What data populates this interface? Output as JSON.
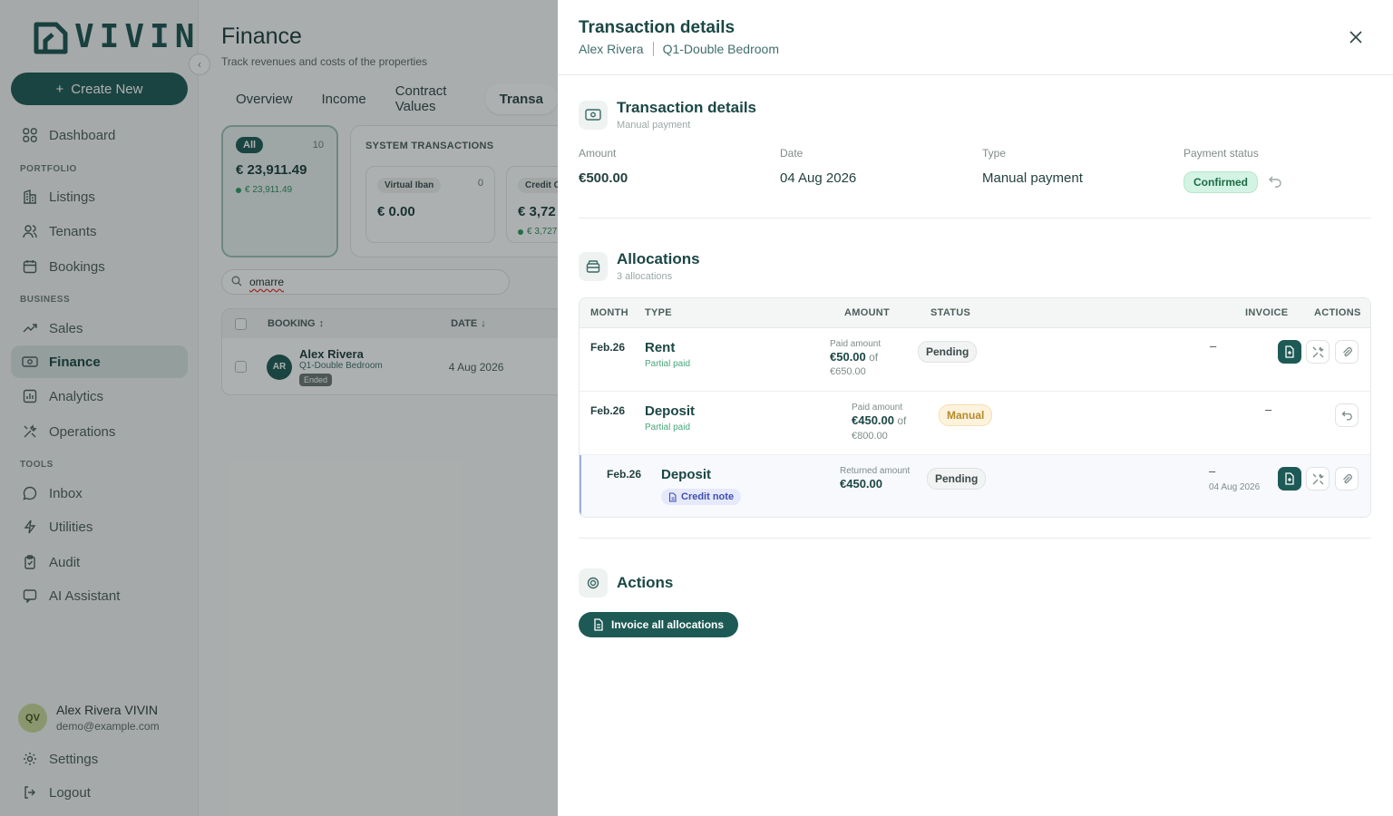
{
  "brand": {
    "name": "VIVIN"
  },
  "sidebar": {
    "create_label": "Create New",
    "dashboard": "Dashboard",
    "sections": {
      "portfolio": "PORTFOLIO",
      "business": "BUSINESS",
      "tools": "TOOLS"
    },
    "items": {
      "listings": "Listings",
      "tenants": "Tenants",
      "bookings": "Bookings",
      "sales": "Sales",
      "finance": "Finance",
      "analytics": "Analytics",
      "operations": "Operations",
      "inbox": "Inbox",
      "utilities": "Utilities",
      "audit": "Audit",
      "ai_assistant": "AI Assistant"
    },
    "user": {
      "initials": "QV",
      "name": "Alex Rivera VIVIN",
      "email": "demo@example.com"
    },
    "settings": "Settings",
    "logout": "Logout"
  },
  "main": {
    "title": "Finance",
    "subtitle": "Track revenues and costs of the properties",
    "tabs": [
      "Overview",
      "Income",
      "Contract Values",
      "Transa"
    ],
    "all_card": {
      "label": "All",
      "count": "10",
      "amount": "€ 23,911.49",
      "sub": "€ 23,911.49"
    },
    "system": {
      "title": "SYSTEM TRANSACTIONS",
      "virtual_iban": {
        "label": "Virtual Iban",
        "count": "0",
        "amount": "€ 0.00"
      },
      "credit": {
        "label": "Credit C",
        "amount": "€ 3,72",
        "sub": "€ 3,727"
      }
    },
    "search": {
      "value": "omarre"
    },
    "table": {
      "headers": {
        "booking": "BOOKING",
        "date": "DATE"
      },
      "row": {
        "initials": "AR",
        "name": "Alex Rivera",
        "room": "Q1-Double Bedroom",
        "status": "Ended",
        "date": "4 Aug 2026"
      }
    }
  },
  "panel": {
    "title": "Transaction details",
    "tenant": "Alex Rivera",
    "room": "Q1-Double Bedroom",
    "details": {
      "title": "Transaction details",
      "subtitle": "Manual payment",
      "amount_label": "Amount",
      "amount": "€500.00",
      "date_label": "Date",
      "date": "04 Aug 2026",
      "type_label": "Type",
      "type": "Manual payment",
      "status_label": "Payment status",
      "status": "Confirmed"
    },
    "allocations": {
      "title": "Allocations",
      "subtitle": "3 allocations",
      "headers": {
        "month": "MONTH",
        "type": "TYPE",
        "amount": "AMOUNT",
        "status": "STATUS",
        "invoice": "INVOICE",
        "actions": "ACTIONS"
      },
      "rows": [
        {
          "month": "Feb.26",
          "type": "Rent",
          "sub": "Partial paid",
          "amount_label": "Paid amount",
          "amount": "€50.00",
          "of": "of",
          "total": "€650.00",
          "status": "Pending",
          "invoice": "–"
        },
        {
          "month": "Feb.26",
          "type": "Deposit",
          "sub": "Partial paid",
          "amount_label": "Paid amount",
          "amount": "€450.00",
          "of": "of",
          "total": "€800.00",
          "status": "Manual",
          "invoice": "–"
        },
        {
          "month": "Feb.26",
          "type": "Deposit",
          "badge": "Credit note",
          "amount_label": "Returned amount",
          "amount": "€450.00",
          "status": "Pending",
          "invoice": "–",
          "invoice_date": "04 Aug 2026"
        }
      ]
    },
    "actions": {
      "title": "Actions",
      "invoice_all": "Invoice all allocations"
    }
  },
  "colors": {
    "brand": "#1e5a55",
    "confirmed_bg": "#d3f4e4",
    "manual_bg": "#fdf3dd",
    "credit_note_bg": "#e6e9fb"
  }
}
